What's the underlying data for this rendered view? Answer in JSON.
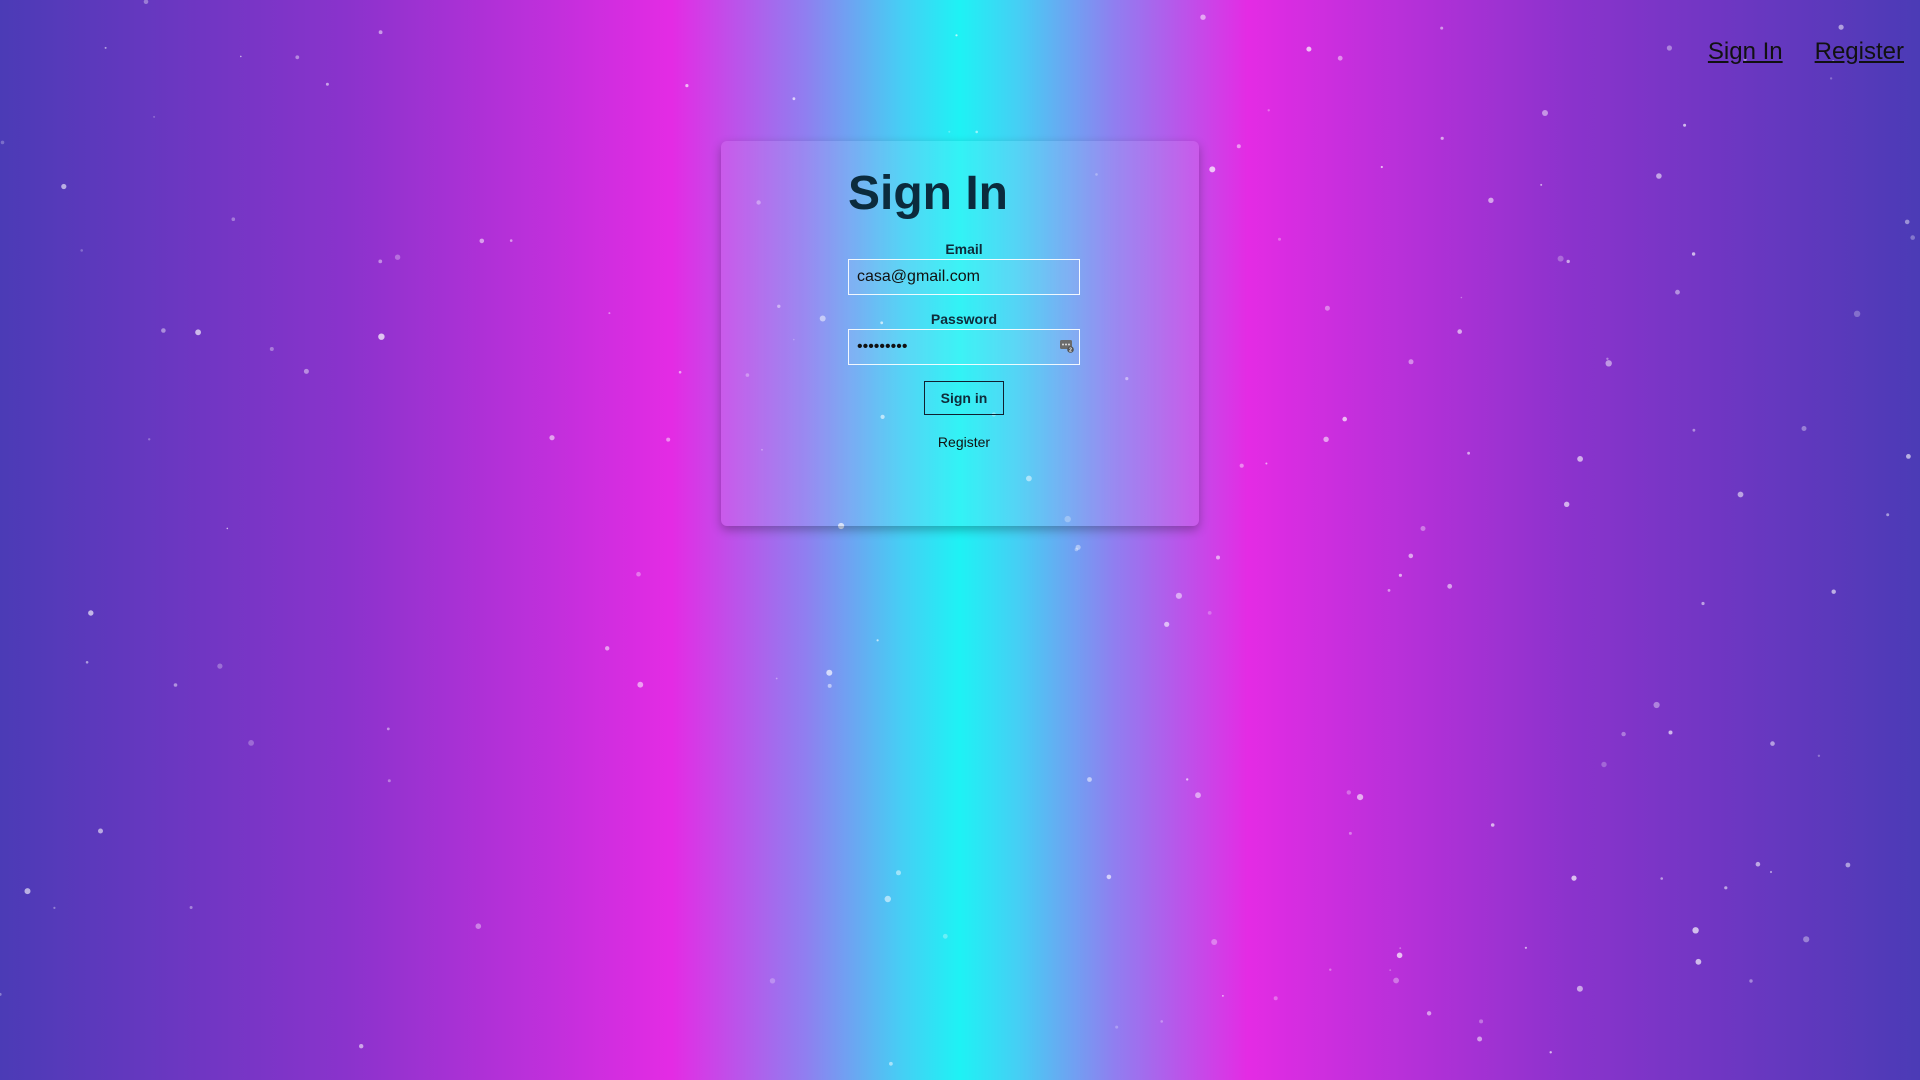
{
  "nav": {
    "sign_in": "Sign In",
    "register": "Register"
  },
  "form": {
    "title": "Sign In",
    "email_label": "Email",
    "email_value": "casa@gmail.com",
    "password_label": "Password",
    "password_value": "password1",
    "password_icon": "password-manager-icon",
    "submit_label": "Sign in",
    "register_link": "Register"
  },
  "colors": {
    "background_edge": "#4b3bb6",
    "background_magenta": "#e42be4",
    "background_cyan": "#1ef2f4",
    "title_text": "#0b2b3d"
  }
}
